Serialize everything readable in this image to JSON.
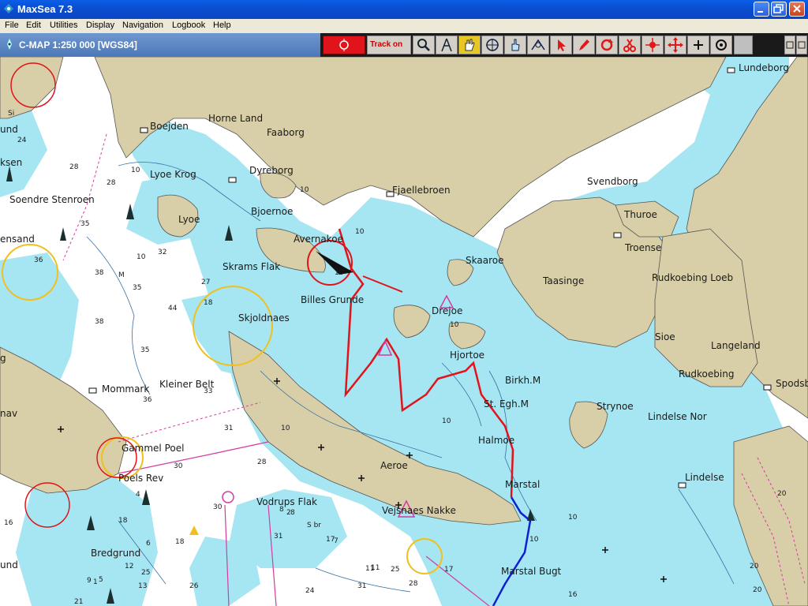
{
  "window": {
    "title": "MaxSea 7.3"
  },
  "menu": {
    "items": [
      "File",
      "Edit",
      "Utilities",
      "Display",
      "Navigation",
      "Logbook",
      "Help"
    ]
  },
  "chart": {
    "title": "C-MAP  1:250 000 [WGS84]"
  },
  "toolbar": {
    "track_label": "Track on"
  },
  "map": {
    "labels": {
      "lundeborg": "Lundeborg",
      "horne_land": "Horne Land",
      "faaborg": "Faaborg",
      "boejden": "Boejden",
      "lyoe_krog": "Lyoe Krog",
      "dyreborg": "Dyreborg",
      "fjaellebroen": "Fjaellebroen",
      "svendborg": "Svendborg",
      "thuroe": "Thuroe",
      "troense": "Troense",
      "soendre_stenroen": "Soendre Stenroen",
      "lyoe": "Lyoe",
      "bjoernoe": "Bjoernoe",
      "avernakoe": "Avernakoe",
      "skrams_flak": "Skrams Flak",
      "skaaroe": "Skaaroe",
      "taasinge": "Taasinge",
      "rudkoebing_loeb": "Rudkoebing Loeb",
      "billes_grunde": "Billes Grunde",
      "drejoe": "Drejoe",
      "skjoldnaes": "Skjoldnaes",
      "hjortoe": "Hjortoe",
      "sioe": "Sioe",
      "langeland": "Langeland",
      "rudkoebing": "Rudkoebing",
      "birkh_m": "Birkh.M",
      "mommark": "Mommark",
      "kleiner_belt": "Kleiner Belt",
      "st_egh_m": "St. Egh.M",
      "strynoe": "Strynoe",
      "lindelse_nor": "Lindelse Nor",
      "spodsb": "Spodsb",
      "halmoe": "Halmoe",
      "gammel_poel": "Gammel Poel",
      "poels_rev": "Poels Rev",
      "aeroe": "Aeroe",
      "marstal": "Marstal",
      "lindelse": "Lindelse",
      "vodrups_flak": "Vodrups Flak",
      "vejsnaes_nakke": "Vejsnaes Nakke",
      "bredgrund": "Bredgrund",
      "marstal_bugt": "Marstal Bugt",
      "ensand": "ensand",
      "und": "und",
      "ksen": "ksen",
      "nav": "nav",
      "s_br": "S br",
      "si": "Si",
      "g": "g",
      "m": "M",
      "und2": "und"
    },
    "soundings": [
      "24",
      "28",
      "28",
      "35",
      "32",
      "36",
      "38",
      "35",
      "27",
      "44",
      "18",
      "38",
      "35",
      "33",
      "36",
      "31",
      "30",
      "28",
      "30",
      "31",
      "18",
      "17",
      "18",
      "12",
      "11",
      "21",
      "26",
      "25",
      "24",
      "31",
      "28",
      "25",
      "17",
      "16",
      "20",
      "13",
      "16",
      "9",
      "8",
      "11",
      "1",
      "6",
      "4",
      "8",
      "7",
      "2",
      "5",
      "10",
      "10",
      "10",
      "10",
      "10",
      "10",
      "10",
      "10",
      "10",
      "10",
      "20",
      "20"
    ],
    "colors": {
      "land": "#d8cfa8",
      "water": "#ffffff",
      "shallow": "#a6e6f2",
      "track_red": "#e0151b",
      "track_blue": "#1020d0",
      "buoy": "#1c2f2f"
    }
  }
}
